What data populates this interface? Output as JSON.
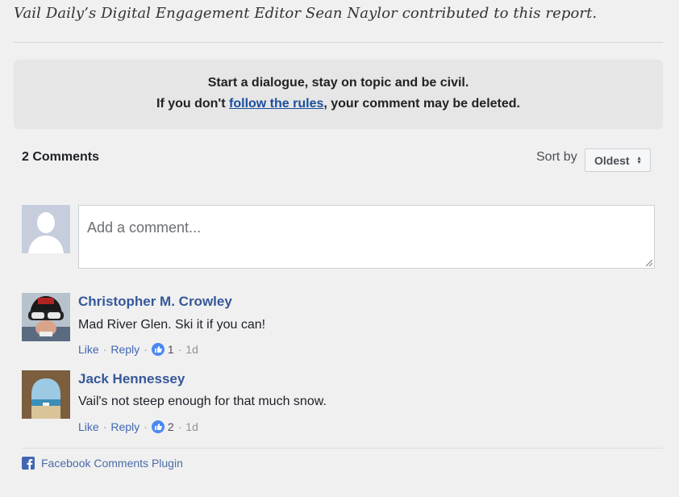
{
  "byline": "Vail Daily’s Digital Engagement Editor Sean Naylor contributed to this report.",
  "notice": {
    "line1": "Start a dialogue, stay on topic and be civil.",
    "line2_before": "If you don't ",
    "line2_link": "follow the rules",
    "line2_after": ", your comment may be deleted."
  },
  "comments_header": {
    "count_label": "2 Comments",
    "sort_label": "Sort by",
    "sort_value": "Oldest"
  },
  "composer": {
    "placeholder": "Add a comment..."
  },
  "comments": [
    {
      "author": "Christopher M. Crowley",
      "text": "Mad River Glen. Ski it if you can!",
      "like_label": "Like",
      "reply_label": "Reply",
      "likes": "1",
      "age": "1d",
      "avatar_icon": "skier-avatar"
    },
    {
      "author": "Jack Hennessey",
      "text": "Vail's not steep enough for that much snow.",
      "like_label": "Like",
      "reply_label": "Reply",
      "likes": "2",
      "age": "1d",
      "avatar_icon": "beach-arch-avatar"
    }
  ],
  "footer": {
    "label": "Facebook Comments Plugin",
    "icon": "facebook-icon"
  },
  "colors": {
    "link": "#365899",
    "action_link": "#4267b2",
    "like_blue": "#4b89f2",
    "notice_bg": "#e6e6e6"
  }
}
